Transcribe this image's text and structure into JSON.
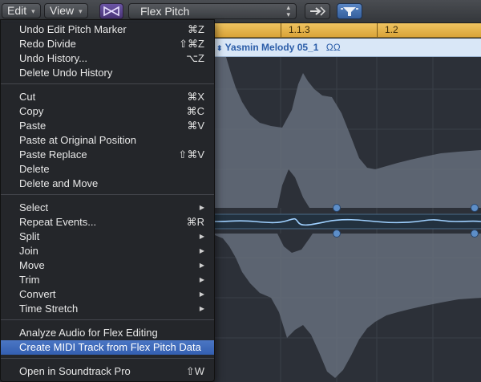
{
  "toolbar": {
    "edit_label": "Edit",
    "view_label": "View",
    "flex_mode": "Flex Pitch"
  },
  "ruler": {
    "labels": [
      "1.1.3",
      "1.2"
    ]
  },
  "region": {
    "name": "Yasmin Melody 05_1",
    "loop_glyph": "ΩΩ"
  },
  "menu": {
    "group1": [
      {
        "label": "Undo Edit Pitch Marker",
        "shortcut": "⌘Z"
      },
      {
        "label": "Redo Divide",
        "shortcut": "⇧⌘Z"
      },
      {
        "label": "Undo History...",
        "shortcut": "⌥Z"
      },
      {
        "label": "Delete Undo History",
        "shortcut": ""
      }
    ],
    "group2": [
      {
        "label": "Cut",
        "shortcut": "⌘X"
      },
      {
        "label": "Copy",
        "shortcut": "⌘C"
      },
      {
        "label": "Paste",
        "shortcut": "⌘V"
      },
      {
        "label": "Paste at Original Position",
        "shortcut": ""
      },
      {
        "label": "Paste Replace",
        "shortcut": "⇧⌘V"
      },
      {
        "label": "Delete",
        "shortcut": ""
      },
      {
        "label": "Delete and Move",
        "shortcut": ""
      }
    ],
    "group3": [
      {
        "label": "Select",
        "shortcut": ""
      },
      {
        "label": "Repeat Events...",
        "shortcut": "⌘R"
      },
      {
        "label": "Split",
        "shortcut": ""
      },
      {
        "label": "Join",
        "shortcut": ""
      },
      {
        "label": "Move",
        "shortcut": ""
      },
      {
        "label": "Trim",
        "shortcut": ""
      },
      {
        "label": "Convert",
        "shortcut": ""
      },
      {
        "label": "Time Stretch",
        "shortcut": ""
      }
    ],
    "group4": [
      {
        "label": "Analyze Audio for Flex Editing",
        "shortcut": ""
      },
      {
        "label": "Create MIDI Track from Flex Pitch Data",
        "shortcut": ""
      }
    ],
    "group5": [
      {
        "label": "Open in Soundtrack Pro",
        "shortcut": "⇧W"
      }
    ],
    "submenu_glyph": "▶"
  },
  "colors": {
    "highlight": "#3d6bbd",
    "ruler": "#e8b74e",
    "region_header": "#d9e7f7",
    "waveform": "#6b7483",
    "pitch_line": "#9fd0ff"
  }
}
